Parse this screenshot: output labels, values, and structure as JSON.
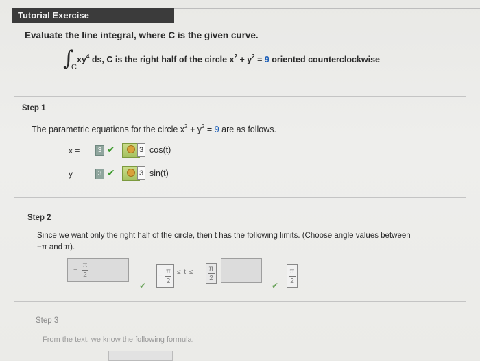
{
  "header": {
    "title": "Tutorial Exercise"
  },
  "question": {
    "prompt": "Evaluate the line integral, where C is the given curve.",
    "integral_sign": "∫",
    "integral_subscript": "C",
    "integrand_x": "xy",
    "integrand_exp": "4",
    "integrand_rest": " ds,  C is the right half of the circle  x",
    "circle_exp_x": "2",
    "circle_plus": " + y",
    "circle_exp_y": "2",
    "circle_eq": " = ",
    "circle_value": "9",
    "circle_tail": " oriented counterclockwise"
  },
  "step1": {
    "label": "Step 1",
    "text_a": "The parametric equations for the circle  x",
    "exp_x": "2",
    "text_b": " + y",
    "exp_y": "2",
    "text_c": " = ",
    "value": "9",
    "text_d": "  are as follows.",
    "x_label": "x  =",
    "y_label": "y  =",
    "x_answer": "3",
    "y_answer": "3",
    "x_value": "3",
    "y_value": "3",
    "x_func": "cos(t)",
    "y_func": "sin(t)"
  },
  "step2": {
    "label": "Step 2",
    "line1": "Since we want only the right half of the circle, then t has the following limits. (Choose angle values between",
    "line2": "−π and π).",
    "left_num": "π",
    "left_den": "2",
    "left_neg": "−",
    "mid_num": "π",
    "mid_den": "2",
    "mid_neg": "−",
    "ineq": "≤ t ≤",
    "right_num": "π",
    "right_den": "2",
    "far_num": "π",
    "far_den": "2"
  },
  "step3": {
    "label": "Step 3",
    "text": "From the text, we know the following formula."
  }
}
